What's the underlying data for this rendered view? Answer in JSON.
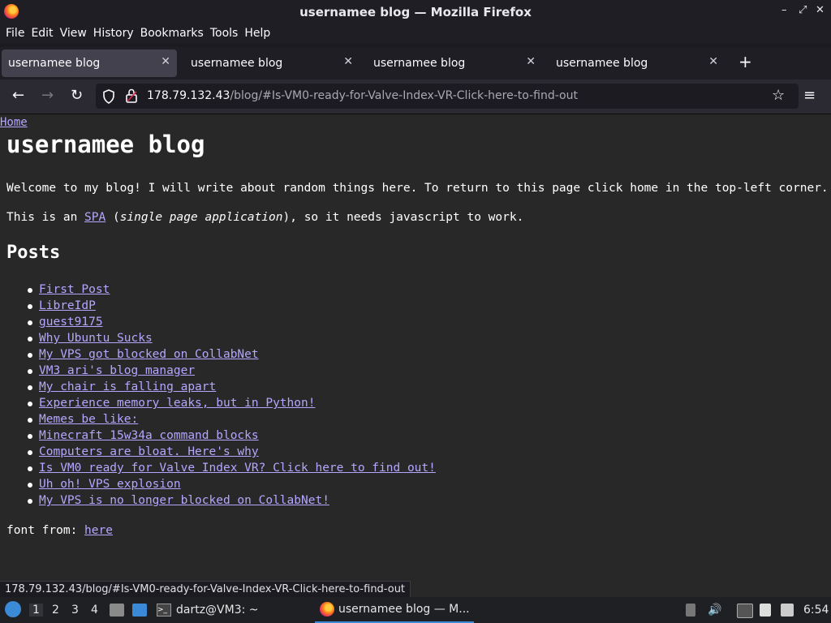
{
  "window": {
    "title": "usernamee blog — Mozilla Firefox",
    "min": "–",
    "restore": "⤢",
    "close": "✕"
  },
  "menu": [
    "File",
    "Edit",
    "View",
    "History",
    "Bookmarks",
    "Tools",
    "Help"
  ],
  "tabs": [
    {
      "label": "usernamee blog",
      "active": true
    },
    {
      "label": "usernamee blog",
      "active": false
    },
    {
      "label": "usernamee blog",
      "active": false
    },
    {
      "label": "usernamee blog",
      "active": false
    }
  ],
  "tab_close": "✕",
  "new_tab": "+",
  "nav": {
    "back": "←",
    "forward": "→",
    "reload": "↻",
    "url_host": "178.79.132.43",
    "url_path": "/blog/#Is-VM0-ready-for-Valve-Index-VR-Click-here-to-find-out",
    "bookmark": "☆",
    "menu": "≡"
  },
  "page": {
    "home_link": "Home",
    "heading": "usernamee blog",
    "welcome": "Welcome to my blog! I will write about random things here. To return to this page click home in the top-left corner.",
    "spa_pre": "This is an ",
    "spa_link": "SPA",
    "spa_paren_open": " (",
    "spa_italic": "single page application",
    "spa_post": "), so it needs javascript to work.",
    "posts_heading": "Posts",
    "posts": [
      "First Post",
      "LibreIdP",
      "guest9175",
      "Why Ubuntu Sucks",
      "My VPS got blocked on CollabNet",
      "VM3 ari's blog manager",
      "My chair is falling apart",
      "Experience memory leaks, but in Python!",
      "Memes be like:",
      "Minecraft 15w34a command blocks",
      "Computers are bloat. Here's why",
      "Is VM0 ready for Valve Index VR? Click here to find out!",
      "Uh oh! VPS explosion",
      "My VPS is no longer blocked on CollabNet!"
    ],
    "font_from": "font from: ",
    "font_link": "here"
  },
  "status_url": "178.79.132.43/blog/#Is-VM0-ready-for-Valve-Index-VR-Click-here-to-find-out",
  "taskbar": {
    "workspaces": [
      "1",
      "2",
      "3",
      "4"
    ],
    "terminal_task": "dartz@VM3: ~",
    "firefox_task": "usernamee blog — M...",
    "clock": "6:54"
  }
}
